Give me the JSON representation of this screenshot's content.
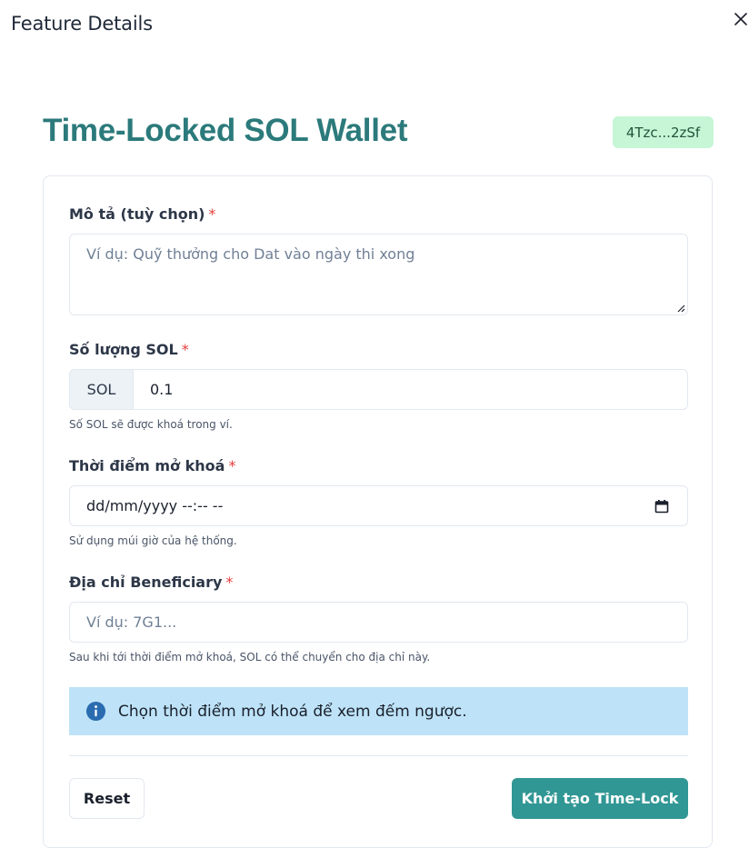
{
  "dialog": {
    "title": "Feature Details"
  },
  "app": {
    "title": "Time-Locked SOL Wallet",
    "wallet_badge": "4Tzc...2zSf"
  },
  "form": {
    "description": {
      "label": "Mô tả (tuỳ chọn)",
      "required_mark": "*",
      "placeholder": "Ví dụ: Quỹ thưởng cho Dat vào ngày thi xong"
    },
    "amount": {
      "label": "Số lượng SOL",
      "required_mark": "*",
      "addon": "SOL",
      "value": "0.1",
      "helper": "Số SOL sẽ được khoá trong ví."
    },
    "unlock_time": {
      "label": "Thời điểm mở khoá",
      "required_mark": "*",
      "value": "dd/mm/yyyy --:-- --",
      "helper": "Sử dụng múi giờ của hệ thống."
    },
    "beneficiary": {
      "label": "Địa chỉ Beneficiary",
      "required_mark": "*",
      "placeholder": "Ví dụ: 7G1...",
      "helper": "Sau khi tới thời điểm mở khoá, SOL có thể chuyển cho địa chỉ này."
    },
    "info_alert": "Chọn thời điểm mở khoá để xem đếm ngược.",
    "buttons": {
      "reset": "Reset",
      "submit": "Khởi tạo Time-Lock"
    }
  },
  "colors": {
    "accent": "#2c7a7b",
    "primary_button": "#319795",
    "badge_bg": "#c6f6d5",
    "alert_bg": "#bee3f8",
    "alert_icon": "#2b6cb0",
    "required": "#e53e3e"
  },
  "icons": {
    "close": "close-icon",
    "calendar": "calendar-icon",
    "info": "info-icon",
    "resize": "resize-grip-icon"
  }
}
